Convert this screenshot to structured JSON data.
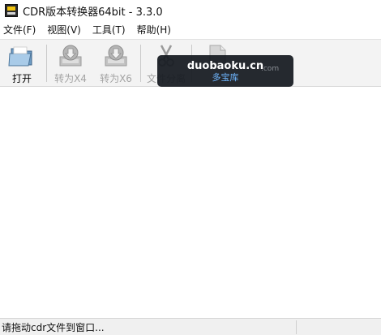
{
  "window": {
    "title": "CDR版本转换器64bit - 3.3.0",
    "icon": "cdr-app-icon"
  },
  "menu": [
    "文件(F)",
    "视图(V)",
    "工具(T)",
    "帮助(H)"
  ],
  "toolbar": {
    "open_label": "打开",
    "to_x4_label": "转为X4",
    "to_x6_label": "转为X6",
    "file_label": "文件分离",
    "icons": {
      "open": "folder-open-icon",
      "to_x4": "save-down-icon",
      "to_x6": "save-down-icon",
      "file": "scissors-icon",
      "doc": "document-icon"
    }
  },
  "watermark": {
    "main": "duobaoku.cn",
    "sub": "多宝库",
    "ghost": ".com"
  },
  "status": {
    "text": "请拖动cdr文件到窗口..."
  },
  "colors": {
    "toolbar_bg": "#f3f3f3",
    "watermark_bg": "#14181e",
    "watermark_sub": "#6fb6ff"
  }
}
